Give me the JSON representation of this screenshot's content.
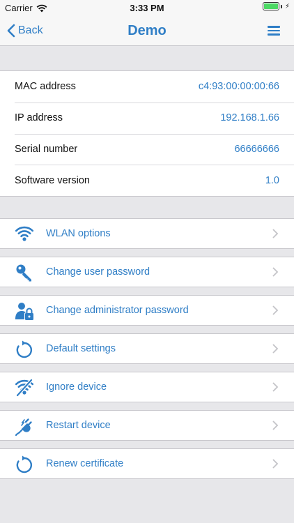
{
  "status_bar": {
    "carrier": "Carrier",
    "time": "3:33 PM"
  },
  "nav": {
    "back_label": "Back",
    "title": "Demo"
  },
  "info": [
    {
      "label": "MAC address",
      "value": "c4:93:00:00:00:66"
    },
    {
      "label": "IP address",
      "value": "192.168.1.66"
    },
    {
      "label": "Serial number",
      "value": "66666666"
    },
    {
      "label": "Software version",
      "value": "1.0"
    }
  ],
  "actions": [
    {
      "label": "WLAN options",
      "icon": "wifi-icon"
    },
    {
      "label": "Change user password",
      "icon": "key-icon"
    },
    {
      "label": "Change administrator password",
      "icon": "admin-lock-icon"
    },
    {
      "label": "Default settings",
      "icon": "reset-icon"
    },
    {
      "label": "Ignore device",
      "icon": "wifi-off-icon"
    },
    {
      "label": "Restart device",
      "icon": "plug-icon"
    },
    {
      "label": "Renew certificate",
      "icon": "renew-icon"
    }
  ],
  "colors": {
    "accent": "#2f7ec6",
    "background": "#e7e7ea",
    "battery": "#4cd964"
  }
}
